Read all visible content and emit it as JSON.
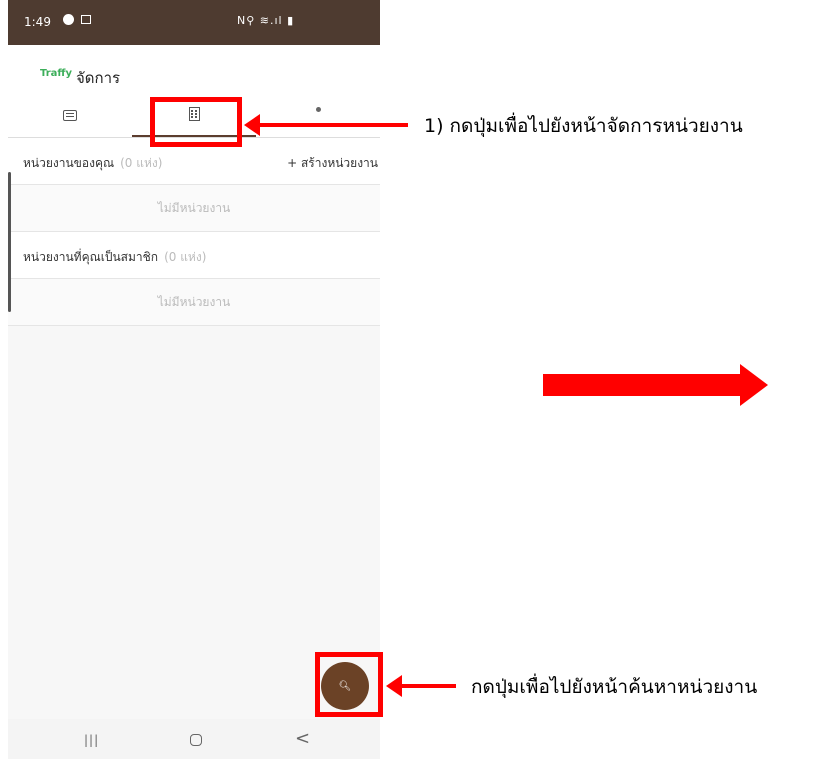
{
  "status_bar": {
    "time": "1:49",
    "system_icons": "N⚲ ≋.ıl ▮"
  },
  "app_bar": {
    "brand": "Traffy",
    "title": "จัดการ"
  },
  "tabs": [
    {
      "icon": "list-icon"
    },
    {
      "icon": "building-icon"
    },
    {
      "icon": "dot-icon"
    }
  ],
  "your_units": {
    "label": "หน่วยงานของคุณ",
    "count": "(0 แห่ง)",
    "create_label": "+ สร้างหน่วยงาน",
    "empty": "ไม่มีหน่วยงาน"
  },
  "member_units": {
    "label": "หน่วยงานที่คุณเป็นสมาชิก",
    "count": "(0 แห่ง)",
    "empty": "ไม่มีหน่วยงาน"
  },
  "nav": {
    "recent": "|||",
    "back": "<"
  },
  "annotations": {
    "tab_hint": "1) กดปุ่มเพื่อไปยังหน้าจัดการหน่วยงาน",
    "search_hint": "กดปุ่มเพื่อไปยังหน้าค้นหาหน่วยงาน"
  },
  "colors": {
    "status_bar": "#4e3b30",
    "accent": "#6b4226",
    "highlight": "#ff0000",
    "brand": "#3cae5a"
  }
}
